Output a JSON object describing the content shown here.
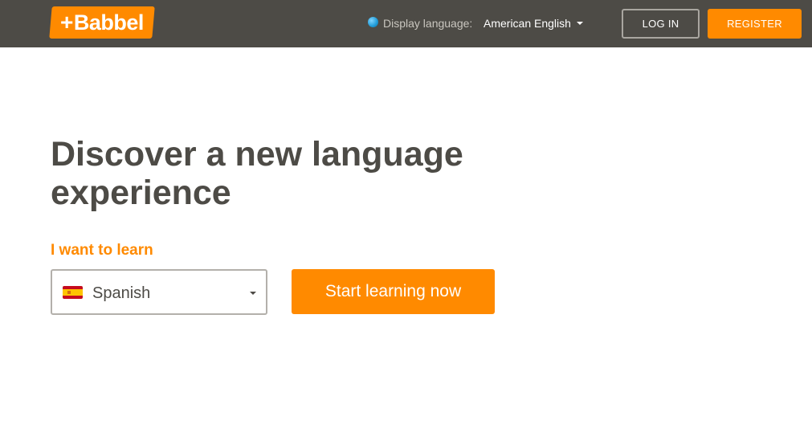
{
  "header": {
    "logo_text": "Babbel",
    "display_language_label": "Display language:",
    "display_language_value": "American English",
    "login_label": "LOG IN",
    "register_label": "REGISTER"
  },
  "hero": {
    "headline": "Discover a new language experience",
    "learn_label": "I want to learn",
    "selected_language": "Spanish",
    "start_button_label": "Start learning now"
  },
  "colors": {
    "brand_orange": "#ff8a00",
    "header_bg": "#4d4b46",
    "text_dark": "#4d4b46"
  },
  "icons": {
    "globe": "globe-icon",
    "flag": "spain-flag-icon",
    "caret": "chevron-down-icon"
  }
}
